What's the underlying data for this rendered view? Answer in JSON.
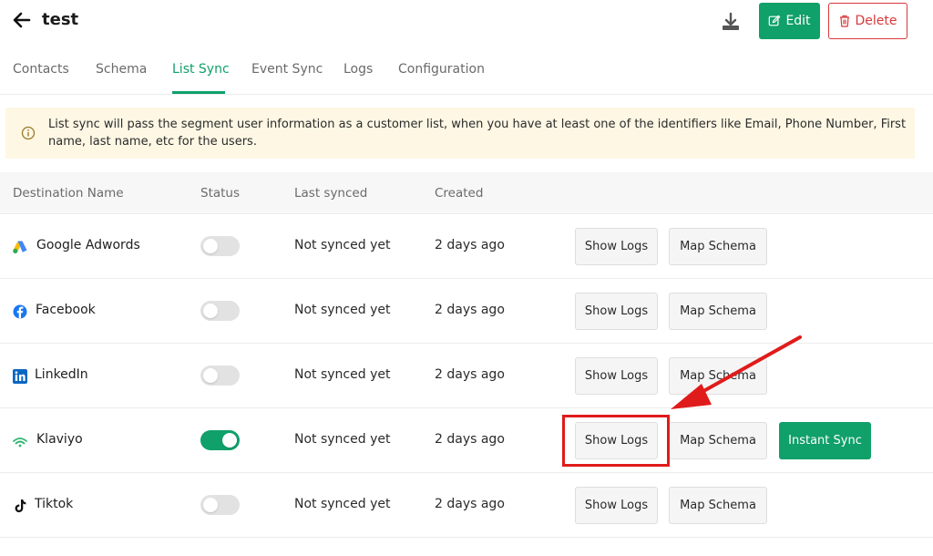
{
  "header": {
    "title": "test",
    "edit_label": "Edit",
    "delete_label": "Delete"
  },
  "tabs": [
    {
      "label": "Contacts",
      "active": false
    },
    {
      "label": "Schema",
      "active": false
    },
    {
      "label": "List Sync",
      "active": true
    },
    {
      "label": "Event Sync",
      "active": false
    },
    {
      "label": "Logs",
      "active": false
    },
    {
      "label": "Configuration",
      "active": false
    }
  ],
  "alert": {
    "text": "List sync will pass the segment user information as a customer list, when you have at least one of the identifiers like Email, Phone Number, First name, last name, etc for the users."
  },
  "table": {
    "headers": [
      "Destination Name",
      "Status",
      "Last synced",
      "Created"
    ],
    "rows": [
      {
        "name": "Google Adwords",
        "logo": "google-ads-icon",
        "enabled": false,
        "last_synced": "Not synced yet",
        "created": "2 days ago",
        "show_logs": "Show Logs",
        "map_schema": "Map Schema"
      },
      {
        "name": "Facebook",
        "logo": "facebook-icon",
        "enabled": false,
        "last_synced": "Not synced yet",
        "created": "2 days ago",
        "show_logs": "Show Logs",
        "map_schema": "Map Schema"
      },
      {
        "name": "LinkedIn",
        "logo": "linkedin-icon",
        "enabled": false,
        "last_synced": "Not synced yet",
        "created": "2 days ago",
        "show_logs": "Show Logs",
        "map_schema": "Map Schema"
      },
      {
        "name": "Klaviyo",
        "logo": "klaviyo-icon",
        "enabled": true,
        "last_synced": "Not synced yet",
        "created": "2 days ago",
        "show_logs": "Show Logs",
        "map_schema": "Map Schema",
        "instant_sync": "Instant Sync"
      },
      {
        "name": "Tiktok",
        "logo": "tiktok-icon",
        "enabled": false,
        "last_synced": "Not synced yet",
        "created": "2 days ago",
        "show_logs": "Show Logs",
        "map_schema": "Map Schema"
      }
    ]
  },
  "colors": {
    "accent": "#10a06a",
    "danger": "#d9383a",
    "alert_bg": "#fdf7e4",
    "annotation": "#e01b1b"
  }
}
